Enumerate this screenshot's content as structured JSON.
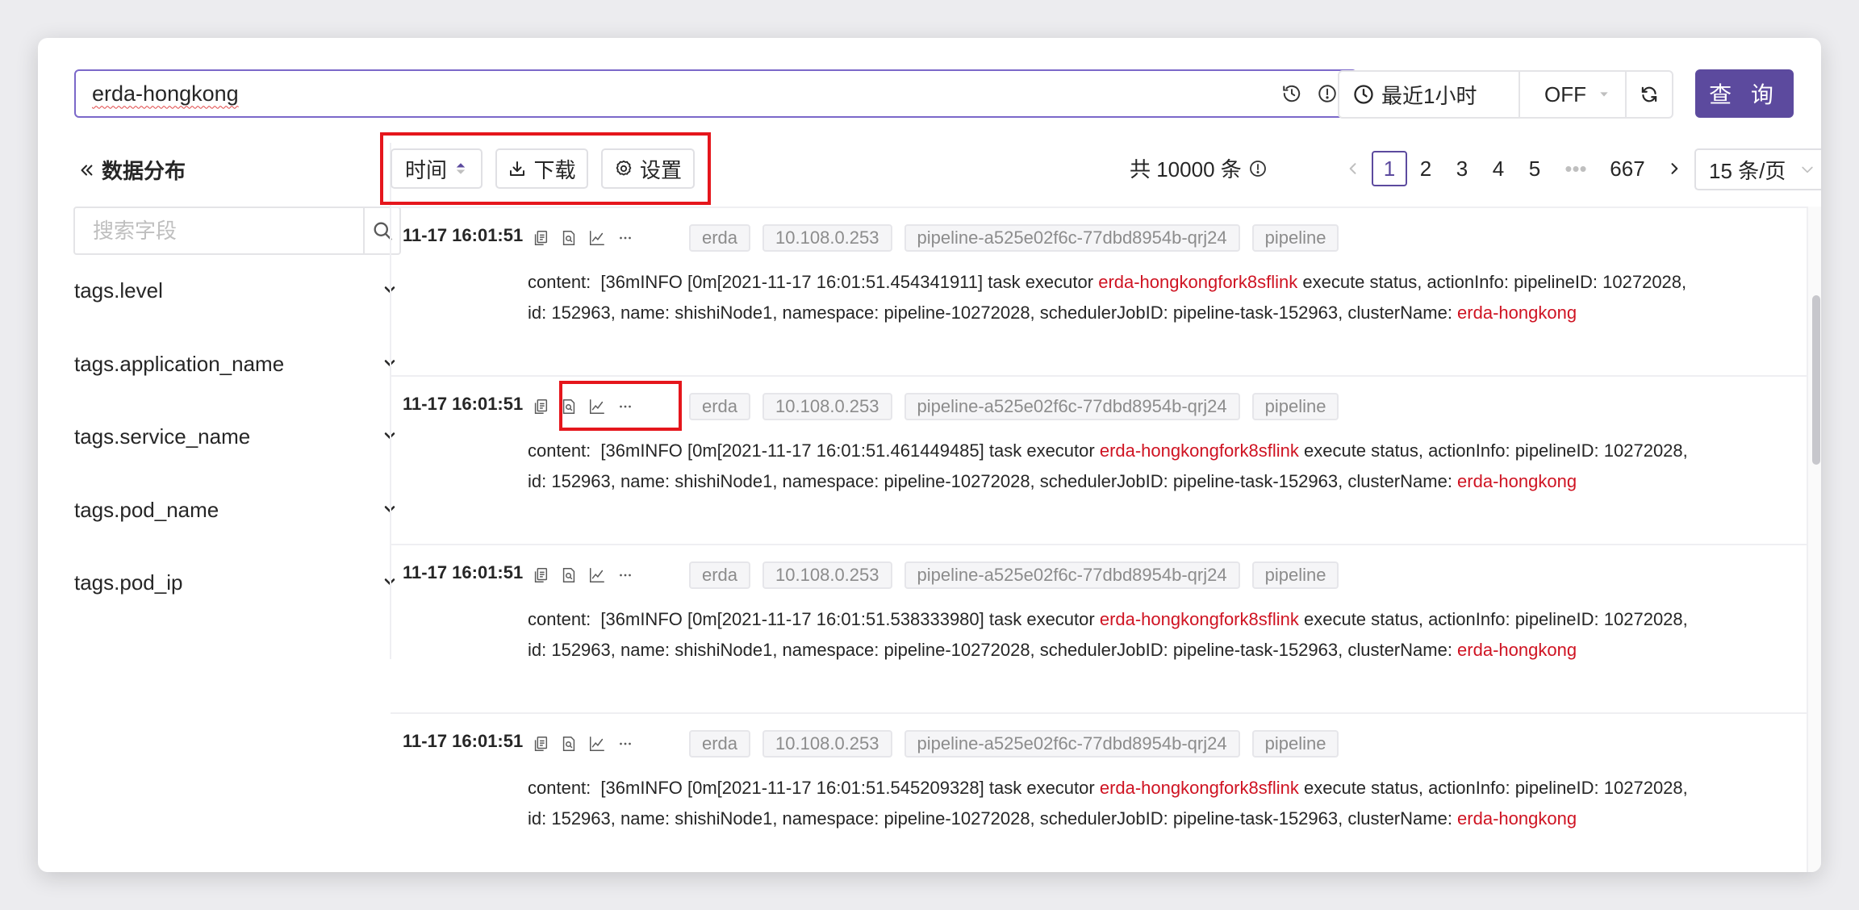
{
  "search": {
    "query": "erda-hongkong"
  },
  "time_range": {
    "label": "最近1小时",
    "auto_refresh": "OFF"
  },
  "query_button": "查 询",
  "sidebar": {
    "title": "数据分布",
    "search_placeholder": "搜索字段",
    "fields": [
      "tags.level",
      "tags.application_name",
      "tags.service_name",
      "tags.pod_name",
      "tags.pod_ip"
    ]
  },
  "toolbar": {
    "time_sort": "时间",
    "download": "下载",
    "settings": "设置"
  },
  "pagination": {
    "total": "共 10000 条",
    "pages": [
      "1",
      "2",
      "3",
      "4",
      "5",
      "•••",
      "667"
    ],
    "current": "1",
    "page_size": "15 条/页"
  },
  "logs": [
    {
      "time": "11-17 16:01:51",
      "tags": [
        "erda",
        "10.108.0.253",
        "pipeline-a525e02f6c-77dbd8954b-qrj24",
        "pipeline"
      ],
      "content_key": "content:",
      "content_pre": "[36mINFO [0m[2021-11-17 16:01:51.454341911] task executor ",
      "content_hl1": "erda-hongkongfork8sflink",
      "content_mid": " execute status, actionInfo: pipelineID: 10272028, id: 152963, name: shishiNode1, namespace: pipeline-10272028, schedulerJobID: pipeline-task-152963, clusterName: ",
      "content_hl2": "erda-hongkong"
    },
    {
      "time": "11-17 16:01:51",
      "tags": [
        "erda",
        "10.108.0.253",
        "pipeline-a525e02f6c-77dbd8954b-qrj24",
        "pipeline"
      ],
      "content_key": "content:",
      "content_pre": "[36mINFO [0m[2021-11-17 16:01:51.461449485] task executor ",
      "content_hl1": "erda-hongkongfork8sflink",
      "content_mid": " execute status, actionInfo: pipelineID: 10272028, id: 152963, name: shishiNode1, namespace: pipeline-10272028, schedulerJobID: pipeline-task-152963, clusterName: ",
      "content_hl2": "erda-hongkong"
    },
    {
      "time": "11-17 16:01:51",
      "tags": [
        "erda",
        "10.108.0.253",
        "pipeline-a525e02f6c-77dbd8954b-qrj24",
        "pipeline"
      ],
      "content_key": "content:",
      "content_pre": "[36mINFO [0m[2021-11-17 16:01:51.538333980] task executor ",
      "content_hl1": "erda-hongkongfork8sflink",
      "content_mid": " execute status, actionInfo: pipelineID: 10272028, id: 152963, name: shishiNode1, namespace: pipeline-10272028, schedulerJobID: pipeline-task-152963, clusterName: ",
      "content_hl2": "erda-hongkong"
    },
    {
      "time": "11-17 16:01:51",
      "tags": [
        "erda",
        "10.108.0.253",
        "pipeline-a525e02f6c-77dbd8954b-qrj24",
        "pipeline"
      ],
      "content_key": "content:",
      "content_pre": "[36mINFO [0m[2021-11-17 16:01:51.545209328] task executor ",
      "content_hl1": "erda-hongkongfork8sflink",
      "content_mid": " execute status, actionInfo: pipelineID: 10272028, id: 152963, name: shishiNode1, namespace: pipeline-10272028, schedulerJobID: pipeline-task-152963, clusterName: ",
      "content_hl2": "erda-hongkong"
    }
  ],
  "colors": {
    "accent": "#5c4a9e",
    "highlight": "#cf1322",
    "annotation": "#e5161c"
  }
}
